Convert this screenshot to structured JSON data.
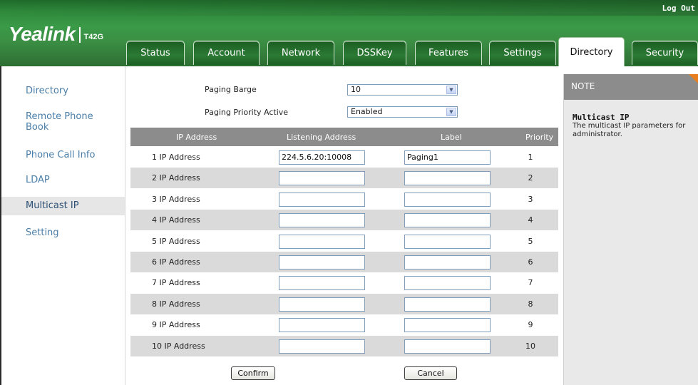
{
  "header": {
    "logo_brand": "Yealink",
    "logo_model": "T42G",
    "logout": "Log Out"
  },
  "tabs": [
    {
      "label": "Status"
    },
    {
      "label": "Account"
    },
    {
      "label": "Network"
    },
    {
      "label": "DSSKey"
    },
    {
      "label": "Features"
    },
    {
      "label": "Settings"
    },
    {
      "label": "Directory",
      "active": true
    },
    {
      "label": "Security"
    }
  ],
  "sidebar": {
    "items": [
      {
        "label": "Directory"
      },
      {
        "label": "Remote Phone\nBook"
      },
      {
        "label": "Phone Call Info"
      },
      {
        "label": "LDAP"
      },
      {
        "label": "Multicast IP",
        "active": true
      },
      {
        "label": "Setting"
      }
    ]
  },
  "form": {
    "paging_barge_label": "Paging Barge",
    "paging_barge_value": "10",
    "paging_priority_label": "Paging Priority Active",
    "paging_priority_value": "Enabled"
  },
  "table": {
    "headers": [
      "IP Address",
      "Listening Address",
      "Label",
      "Priority"
    ],
    "rows": [
      {
        "name": "1  IP Address",
        "address": "224.5.6.20:10008",
        "label": "Paging1",
        "priority": "1"
      },
      {
        "name": "2  IP Address",
        "address": "",
        "label": "",
        "priority": "2"
      },
      {
        "name": "3  IP Address",
        "address": "",
        "label": "",
        "priority": "3"
      },
      {
        "name": "4  IP Address",
        "address": "",
        "label": "",
        "priority": "4"
      },
      {
        "name": "5  IP Address",
        "address": "",
        "label": "",
        "priority": "5"
      },
      {
        "name": "6  IP Address",
        "address": "",
        "label": "",
        "priority": "6"
      },
      {
        "name": "7  IP Address",
        "address": "",
        "label": "",
        "priority": "7"
      },
      {
        "name": "8  IP Address",
        "address": "",
        "label": "",
        "priority": "8"
      },
      {
        "name": "9  IP Address",
        "address": "",
        "label": "",
        "priority": "9"
      },
      {
        "name": "10  IP Address",
        "address": "",
        "label": "",
        "priority": "10"
      }
    ]
  },
  "buttons": {
    "confirm": "Confirm",
    "cancel": "Cancel"
  },
  "note": {
    "heading": "NOTE",
    "title": "Multicast IP",
    "body": "The multicast IP parameters for administrator."
  },
  "colors": {
    "header_green": "#3a9a47",
    "link_blue": "#4a7ea8",
    "table_header_gray": "#8c8c8c",
    "row_alt_gray": "#dadada",
    "note_accent": "#e87d1e"
  }
}
